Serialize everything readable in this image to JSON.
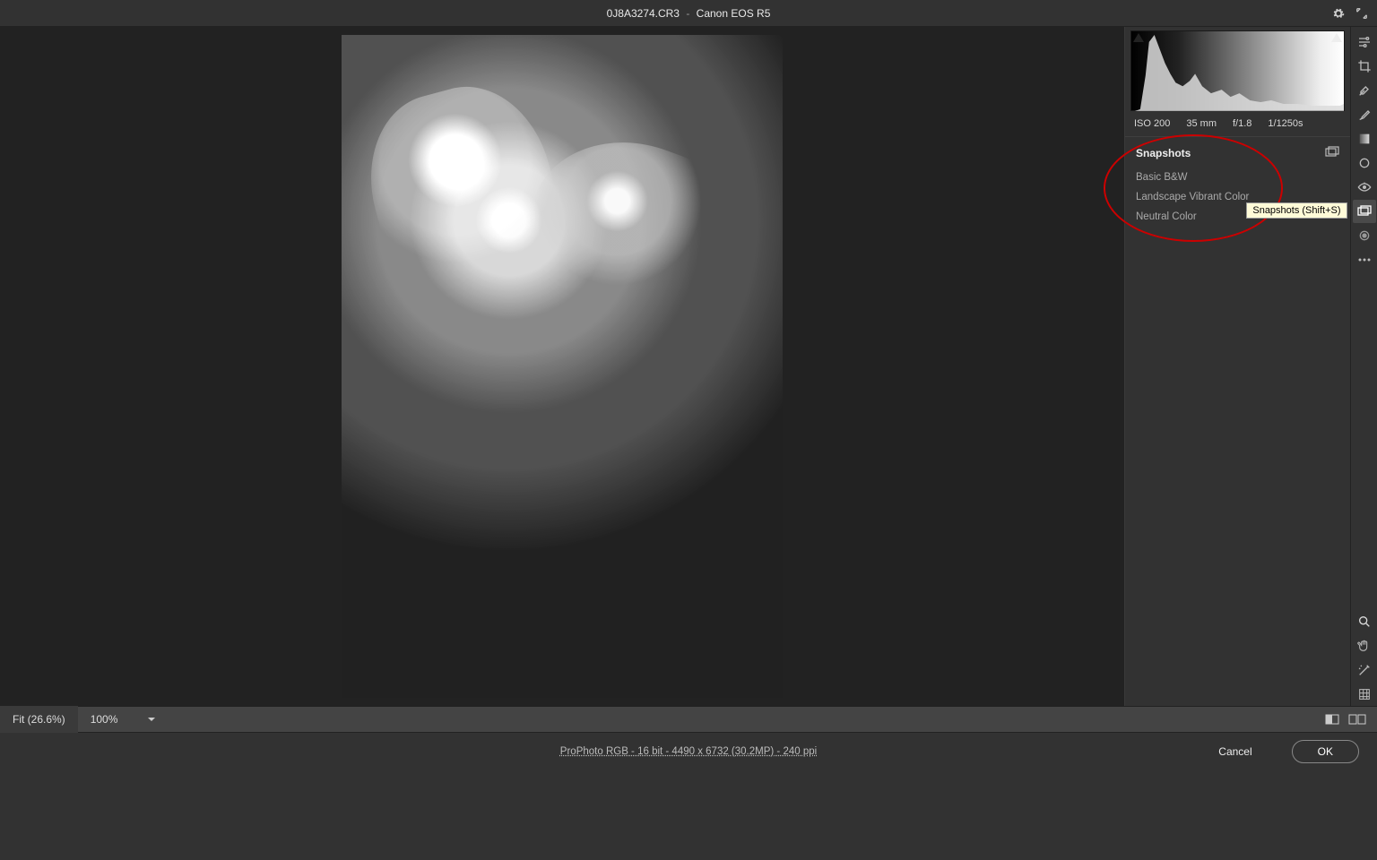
{
  "title": {
    "file": "0J8A3274.CR3",
    "sep": "-",
    "camera": "Canon EOS R5"
  },
  "meta": {
    "iso": "ISO 200",
    "focal": "35 mm",
    "aperture": "f/1.8",
    "shutter": "1/1250s"
  },
  "snapshots": {
    "label": "Snapshots",
    "items": [
      {
        "label": "Basic B&W"
      },
      {
        "label": "Landscape Vibrant Color"
      },
      {
        "label": "Neutral Color"
      }
    ]
  },
  "tools": {
    "tooltip": "Snapshots (Shift+S)"
  },
  "zoom": {
    "fit": "Fit (26.6%)",
    "hundred": "100%"
  },
  "footer": {
    "info": "ProPhoto RGB - 16 bit - 4490 x 6732 (30.2MP) - 240 ppi",
    "cancel": "Cancel",
    "ok": "OK"
  }
}
